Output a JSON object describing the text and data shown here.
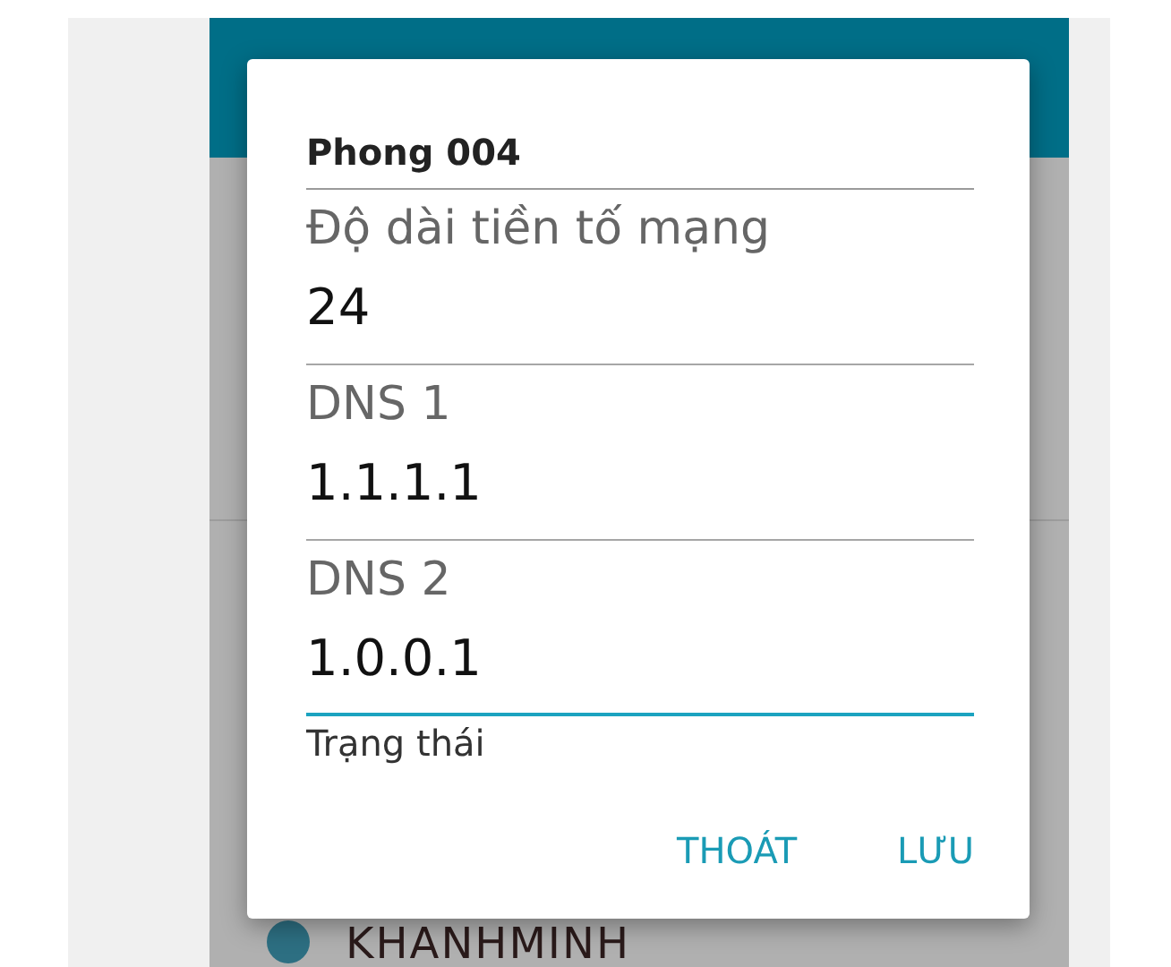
{
  "dialog": {
    "title": "Phong 004",
    "fields": [
      {
        "label": "Độ dài tiền tố mạng",
        "value": "24",
        "focused": false
      },
      {
        "label": "DNS 1",
        "value": "1.1.1.1",
        "focused": false
      },
      {
        "label": "DNS 2",
        "value": "1.0.0.1",
        "focused": true
      }
    ],
    "status_label": "Trạng thái",
    "buttons": [
      "THOÁT",
      "LƯU"
    ]
  },
  "background_list": [
    {
      "name": "KHANHMINH"
    }
  ]
}
